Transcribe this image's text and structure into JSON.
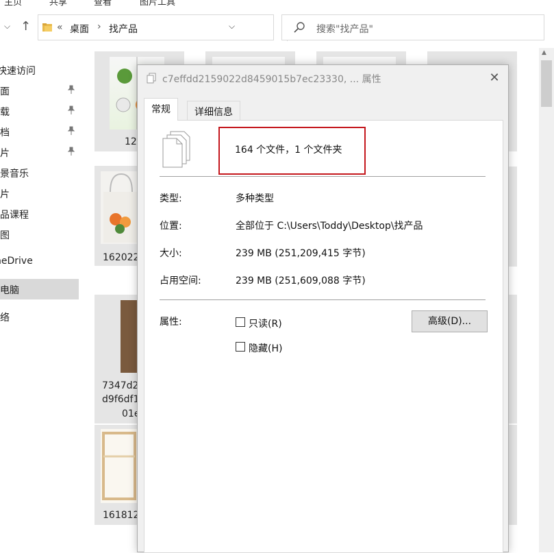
{
  "ribbon": {
    "tabs": [
      "主页",
      "共享",
      "查看",
      "图片工具"
    ]
  },
  "address_bar": {
    "overflow": "«",
    "crumbs": [
      "桌面",
      "找产品"
    ],
    "separator": "›",
    "search_placeholder": "搜索\"找产品\""
  },
  "sidebar": {
    "items": [
      {
        "label": "快速访问",
        "pinned": false
      },
      {
        "label": "桌面",
        "pinned": true
      },
      {
        "label": "下载",
        "pinned": true
      },
      {
        "label": "文档",
        "pinned": true
      },
      {
        "label": "图片",
        "pinned": true
      },
      {
        "label": "背景音乐",
        "pinned": false
      },
      {
        "label": "照片",
        "pinned": false
      },
      {
        "label": "商品课程",
        "pinned": false
      },
      {
        "label": "截图",
        "pinned": false
      },
      {
        "label": "OneDrive",
        "pinned": false
      },
      {
        "label": "此电脑",
        "pinned": false,
        "selected": true
      },
      {
        "label": "网络",
        "pinned": false
      }
    ]
  },
  "files": {
    "captions": [
      "12",
      "162022",
      "7347d2",
      "d9f6df1",
      "01e",
      "161812"
    ]
  },
  "dialog": {
    "title": "c7effdd2159022d8459015b7ec23330, ... 属性",
    "tabs": [
      "常规",
      "详细信息"
    ],
    "active_tab": "常规",
    "summary": "164 个文件，1 个文件夹",
    "highlight_color": "#c4161c",
    "rows": [
      {
        "label": "类型:",
        "value": "多种类型"
      },
      {
        "label": "位置:",
        "value": "全部位于 C:\\Users\\Toddy\\Desktop\\找产品"
      },
      {
        "label": "大小:",
        "value": "239 MB (251,209,415 字节)"
      },
      {
        "label": "占用空间:",
        "value": "239 MB (251,609,088 字节)"
      }
    ],
    "attributes_label": "属性:",
    "readonly_label": "只读(R)",
    "readonly_checked": false,
    "hidden_label": "隐藏(H)",
    "hidden_checked": false,
    "advanced_button": "高级(D)..."
  }
}
